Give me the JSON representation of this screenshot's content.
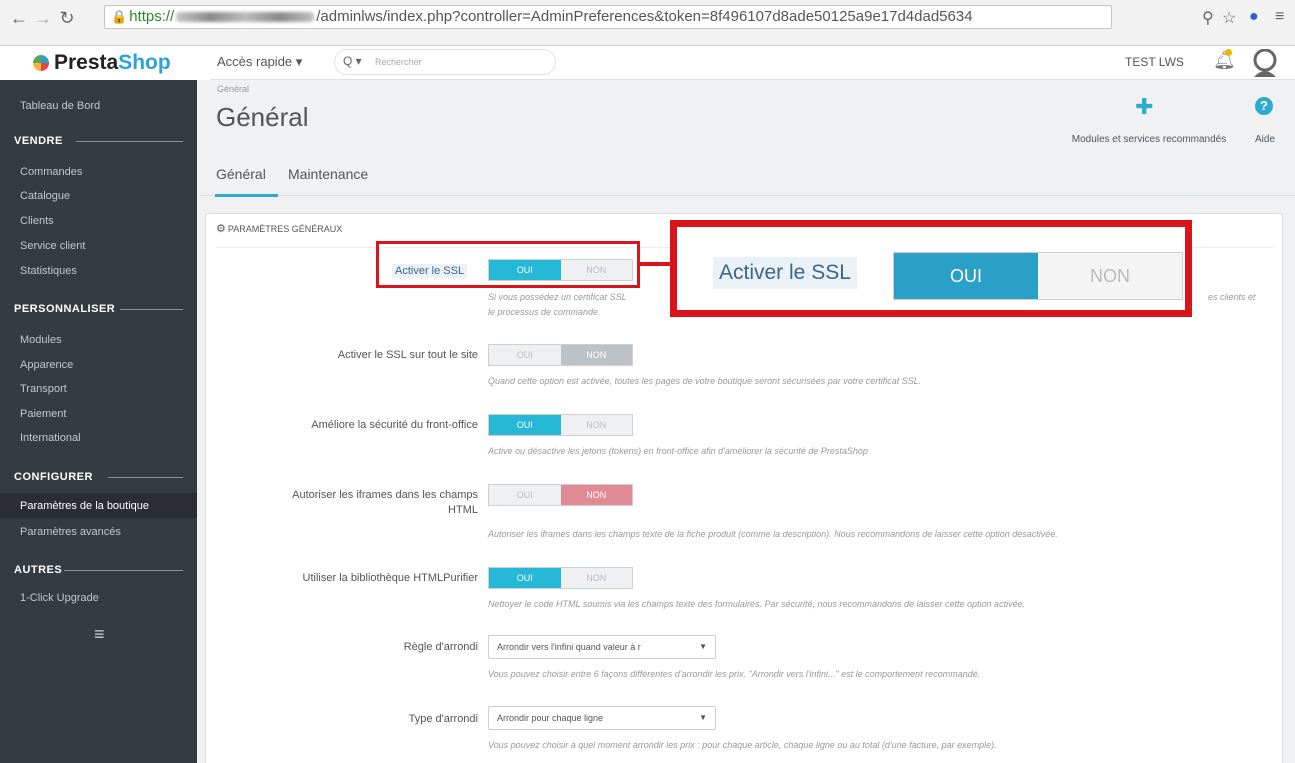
{
  "browser": {
    "url_https": "https://",
    "url_rest": "/adminlws/index.php?controller=AdminPreferences&token=8f496107d8ade50125a9e17d4dad5634"
  },
  "header": {
    "logo_presta": "Presta",
    "logo_shop": "Shop",
    "quick_access": "Accès rapide ▾",
    "search_prefix": "Q ▾",
    "search_placeholder": "Rechercher",
    "shop_name": "TEST LWS"
  },
  "sidebar": {
    "dashboard": "Tableau de Bord",
    "sections": [
      {
        "title": "VENDRE",
        "items": [
          "Commandes",
          "Catalogue",
          "Clients",
          "Service client",
          "Statistiques"
        ]
      },
      {
        "title": "PERSONNALISER",
        "items": [
          "Modules",
          "Apparence",
          "Transport",
          "Paiement",
          "International"
        ]
      },
      {
        "title": "CONFIGURER",
        "items": [
          "Paramètres de la boutique",
          "Paramètres avancés"
        ]
      },
      {
        "title": "AUTRES",
        "items": [
          "1-Click Upgrade"
        ]
      }
    ],
    "menu_glyph": "≡"
  },
  "page": {
    "breadcrumb": "Général",
    "title": "Général",
    "toolbar": {
      "modules": "Modules et services recommandés",
      "help": "Aide"
    },
    "tabs": [
      "Général",
      "Maintenance"
    ],
    "panel_title": "PARAMÈTRES GÉNÉRAUX"
  },
  "form": {
    "ssl": {
      "label": "Activer le SSL",
      "on": "OUI",
      "off": "NON",
      "help_left": "Si vous possédez un certificat SSL",
      "help_line2": "le processus de commande.",
      "help_right": "es clients et"
    },
    "ssl_all": {
      "label": "Activer le SSL sur tout le site",
      "on": "OUI",
      "off": "NON",
      "help": "Quand cette option est activée, toutes les pages de votre boutique seront sécurisées par votre certificat SSL."
    },
    "front_security": {
      "label": "Améliore la sécurité du front-office",
      "on": "OUI",
      "off": "NON",
      "help": "Active ou désactive les jetons (tokens) en front-office afin d'améliorer la sécurité de PrestaShop"
    },
    "iframes": {
      "label_1": "Autoriser les iframes dans les champs",
      "label_2": "HTML",
      "on": "OUI",
      "off": "NON",
      "help": "Autoriser les iframes dans les champs texte de la fiche produit (comme la description). Nous recommandons de laisser cette option désactivée."
    },
    "purifier": {
      "label": "Utiliser la bibliothèque HTMLPurifier",
      "on": "OUI",
      "off": "NON",
      "help": "Nettoyer le code HTML soumis via les champs texte des formulaires. Par sécurité, nous recommandons de laisser cette option activée."
    },
    "rounding_rule": {
      "label": "Règle d'arrondi",
      "value": "Arrondir vers l'infini quand valeur à r",
      "help": "Vous pouvez choisir entre 6 façons différentes d'arrondir les prix. \"Arrondir vers l'infini...\" est le comportement recommandé."
    },
    "rounding_type": {
      "label": "Type d'arrondi",
      "value": "Arrondir pour chaque ligne",
      "help": "Vous pouvez choisir à quel moment arrondir les prix : pour chaque article, chaque ligne ou au total (d'une facture, par exemple)."
    }
  },
  "zoom_callout": {
    "label": "Activer le SSL",
    "on": "OUI",
    "off": "NON"
  },
  "colors": {
    "accent": "#25b9d7",
    "sidebar": "#363a41",
    "highlight": "#d9141b",
    "danger": "#e08a94"
  }
}
